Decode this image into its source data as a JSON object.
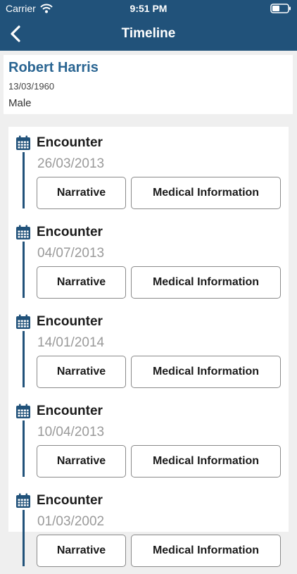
{
  "status_bar": {
    "carrier": "Carrier",
    "time": "9:51 PM"
  },
  "nav": {
    "title": "Timeline",
    "back_icon": "chevron-left-icon"
  },
  "patient": {
    "name": "Robert Harris",
    "dob": "13/03/1960",
    "gender": "Male"
  },
  "timeline": {
    "entries": [
      {
        "title": "Encounter",
        "date": "26/03/2013",
        "narrative_label": "Narrative",
        "medical_label": "Medical Information"
      },
      {
        "title": "Encounter",
        "date": "04/07/2013",
        "narrative_label": "Narrative",
        "medical_label": "Medical Information"
      },
      {
        "title": "Encounter",
        "date": "14/01/2014",
        "narrative_label": "Narrative",
        "medical_label": "Medical Information"
      },
      {
        "title": "Encounter",
        "date": "10/04/2013",
        "narrative_label": "Narrative",
        "medical_label": "Medical Information"
      },
      {
        "title": "Encounter",
        "date": "01/03/2002",
        "narrative_label": "Narrative",
        "medical_label": "Medical Information"
      }
    ]
  },
  "colors": {
    "header": "#21527a",
    "accent": "#2a6592",
    "date_text": "#9a9a9a"
  }
}
